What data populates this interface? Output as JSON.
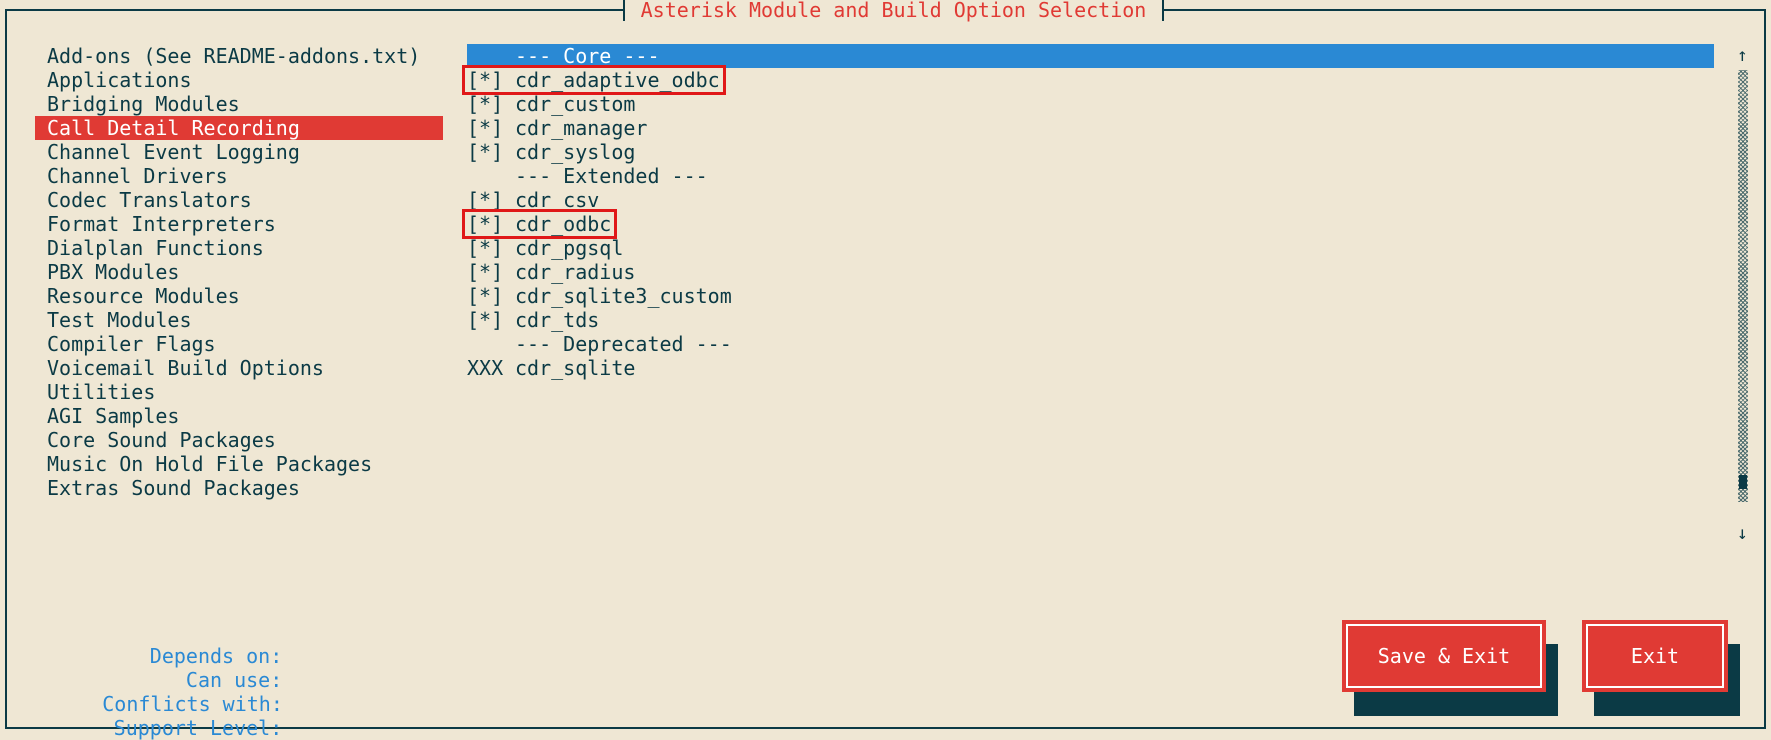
{
  "window": {
    "title": "Asterisk Module and Build Option Selection"
  },
  "categories": {
    "selected_index": 3,
    "items": [
      {
        "label": "Add-ons (See README-addons.txt)"
      },
      {
        "label": "Applications"
      },
      {
        "label": "Bridging Modules"
      },
      {
        "label": "Call Detail Recording"
      },
      {
        "label": "Channel Event Logging"
      },
      {
        "label": "Channel Drivers"
      },
      {
        "label": "Codec Translators"
      },
      {
        "label": "Format Interpreters"
      },
      {
        "label": "Dialplan Functions"
      },
      {
        "label": "PBX Modules"
      },
      {
        "label": "Resource Modules"
      },
      {
        "label": "Test Modules"
      },
      {
        "label": "Compiler Flags"
      },
      {
        "label": "Voicemail Build Options"
      },
      {
        "label": "Utilities"
      },
      {
        "label": "AGI Samples"
      },
      {
        "label": "Core Sound Packages"
      },
      {
        "label": "Music On Hold File Packages"
      },
      {
        "label": "Extras Sound Packages"
      }
    ]
  },
  "modules": {
    "items": [
      {
        "type": "header",
        "label": "--- Core ---",
        "highlighted": true
      },
      {
        "type": "module",
        "mark": "[*]",
        "name": "cdr_adaptive_odbc",
        "annotated": true
      },
      {
        "type": "module",
        "mark": "[*]",
        "name": "cdr_custom"
      },
      {
        "type": "module",
        "mark": "[*]",
        "name": "cdr_manager"
      },
      {
        "type": "module",
        "mark": "[*]",
        "name": "cdr_syslog"
      },
      {
        "type": "header",
        "label": "--- Extended ---"
      },
      {
        "type": "module",
        "mark": "[*]",
        "name": "cdr_csv"
      },
      {
        "type": "module",
        "mark": "[*]",
        "name": "cdr_odbc",
        "annotated": true
      },
      {
        "type": "module",
        "mark": "[*]",
        "name": "cdr_pgsql"
      },
      {
        "type": "module",
        "mark": "[*]",
        "name": "cdr_radius"
      },
      {
        "type": "module",
        "mark": "[*]",
        "name": "cdr_sqlite3_custom"
      },
      {
        "type": "module",
        "mark": "[*]",
        "name": "cdr_tds"
      },
      {
        "type": "header",
        "label": "--- Deprecated ---"
      },
      {
        "type": "module",
        "mark": "XXX",
        "name": "cdr_sqlite"
      }
    ]
  },
  "scrollbar": {
    "up_arrow": "↑",
    "down_arrow": "↓",
    "position": 0.97
  },
  "info": {
    "depends_on_label": "Depends on:",
    "can_use_label": "Can use:",
    "conflicts_with_label": "Conflicts with:",
    "support_level_label": "Support Level:"
  },
  "buttons": {
    "save_exit": "Save & Exit",
    "exit": "Exit"
  },
  "colors": {
    "background": "#efe7d4",
    "text": "#0b3a45",
    "accent_red": "#e03a34",
    "highlight_blue": "#2a89d4",
    "annotation_red": "#e01818"
  }
}
